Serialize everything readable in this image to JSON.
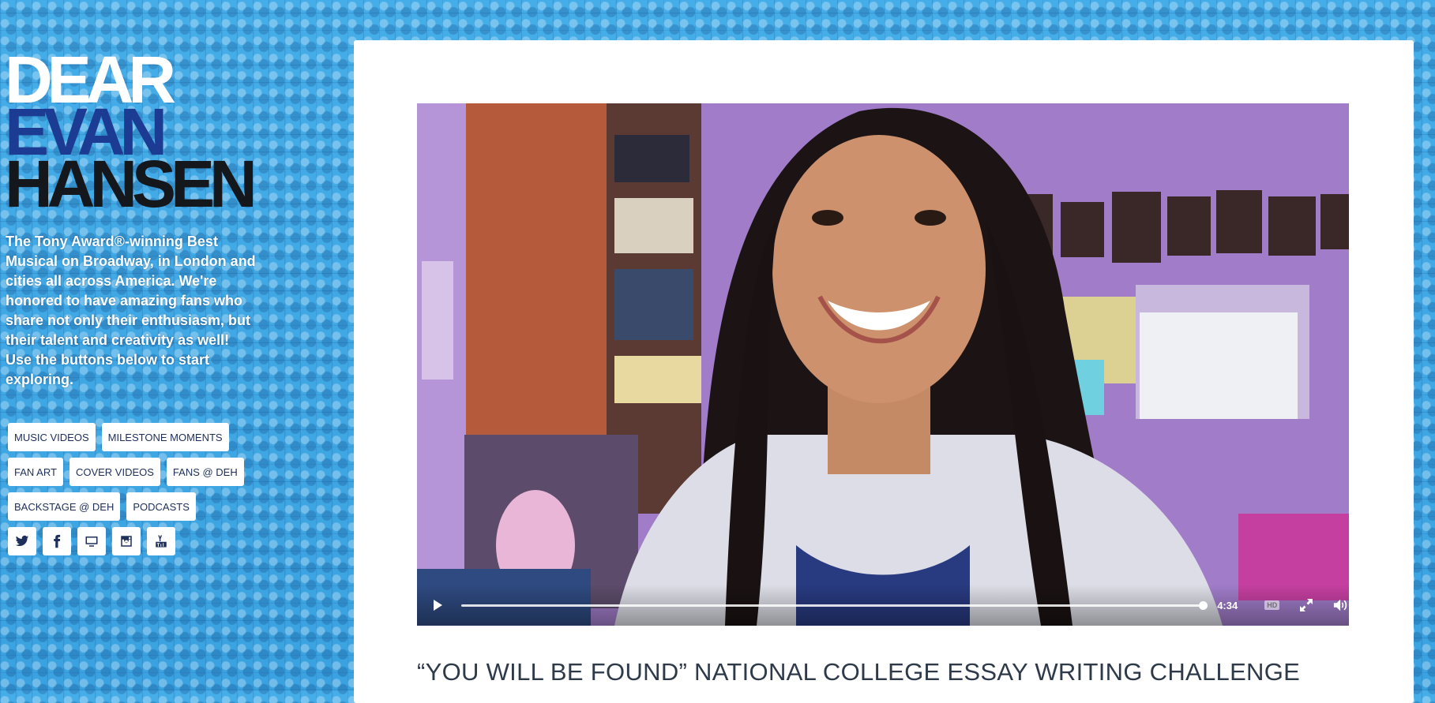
{
  "logo": {
    "line1": "DEAR",
    "line2": "EVAN",
    "line3": "HANSEN"
  },
  "intro_text": "The Tony Award®-winning Best Musical on Broadway, in London and cities all across America. We're honored to have amazing fans who share not only their enthusiasm, but their talent and creativity as well! Use the buttons below to start exploring.",
  "nav": {
    "music_videos": "MUSIC VIDEOS",
    "milestone_moments": "MILESTONE MOMENTS",
    "fan_art": "FAN ART",
    "cover_videos": "COVER VIDEOS",
    "fans_deh": "FANS @ DEH",
    "backstage_deh": "BACKSTAGE @ DEH",
    "podcasts": "PODCASTS"
  },
  "social": [
    "twitter-icon",
    "facebook-icon",
    "tv-icon",
    "instagram-icon",
    "youtube-icon"
  ],
  "video": {
    "duration": "4:34",
    "quality": "HD",
    "progress": 1.0
  },
  "video_title": "“YOU WILL BE FOUND” NATIONAL COLLEGE ESSAY WRITING CHALLENGE",
  "colors": {
    "background": "#3fa9e6",
    "logo_blue": "#1c3b92",
    "logo_dark": "#14171c",
    "button_text": "#1d2f5a",
    "title_text": "#2e3a4a"
  }
}
